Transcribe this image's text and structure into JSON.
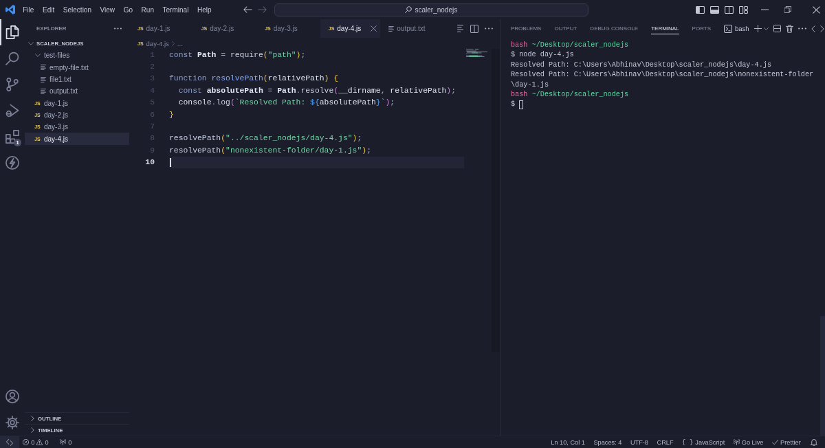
{
  "title_bar": {
    "menu": [
      "File",
      "Edit",
      "Selection",
      "View",
      "Go",
      "Run",
      "Terminal",
      "Help"
    ],
    "search": "scaler_nodejs"
  },
  "activity_bar": {
    "items": [
      {
        "kind": "explorer",
        "selected": true
      },
      {
        "kind": "search",
        "selected": false
      },
      {
        "kind": "source-control",
        "selected": false
      },
      {
        "kind": "run-debug",
        "selected": false
      },
      {
        "kind": "extensions",
        "selected": false,
        "badge": "1"
      },
      {
        "kind": "lightning",
        "selected": false
      }
    ],
    "bottom": [
      {
        "kind": "account"
      },
      {
        "kind": "settings"
      }
    ]
  },
  "sidebar": {
    "title": "EXPLORER",
    "folder": {
      "label": "SCALER_NODEJS",
      "expanded": true,
      "children": [
        {
          "label": "test-files",
          "kind": "folder",
          "expanded": true,
          "selected": false,
          "children": [
            {
              "label": "empty-file.txt",
              "kind": "text",
              "selected": false
            },
            {
              "label": "file1.txt",
              "kind": "text",
              "selected": false
            },
            {
              "label": "output.txt",
              "kind": "text",
              "selected": false
            }
          ]
        },
        {
          "label": "day-1.js",
          "kind": "js",
          "icon_text": "JS",
          "selected": false
        },
        {
          "label": "day-2.js",
          "kind": "js",
          "icon_text": "JS",
          "selected": false
        },
        {
          "label": "day-3.js",
          "kind": "js",
          "icon_text": "JS",
          "selected": false
        },
        {
          "label": "day-4.js",
          "kind": "js",
          "icon_text": "JS",
          "selected": true
        }
      ]
    },
    "sections": [
      {
        "label": "OUTLINE",
        "expanded": false
      },
      {
        "label": "TIMELINE",
        "expanded": false
      }
    ]
  },
  "editor": {
    "tabs": [
      {
        "label": "day-1.js",
        "kind": "js",
        "icon_text": "JS",
        "selected": false
      },
      {
        "label": "day-2.js",
        "kind": "js",
        "icon_text": "JS",
        "selected": false
      },
      {
        "label": "day-3.js",
        "kind": "js",
        "icon_text": "JS",
        "selected": false
      },
      {
        "label": "day-4.js",
        "kind": "js",
        "icon_text": "JS",
        "selected": true
      },
      {
        "label": "output.txt",
        "kind": "text",
        "selected": false
      }
    ],
    "breadcrumb": [
      {
        "label": "day-4.js",
        "kind": "js",
        "icon_text": "JS"
      },
      {
        "label": "...",
        "kind": "more"
      }
    ],
    "lines": [
      {
        "number": "1",
        "current": false,
        "tokens": [
          {
            "text": "const ",
            "kind": "keyword"
          },
          {
            "text": "Path",
            "kind": "variable"
          },
          {
            "text": " = ",
            "kind": "plain"
          },
          {
            "text": "require",
            "kind": "call"
          },
          {
            "text": "(",
            "kind": "bracket1"
          },
          {
            "text": "\"path\"",
            "kind": "string"
          },
          {
            "text": ")",
            "kind": "bracket1"
          },
          {
            "text": ";",
            "kind": "plain"
          }
        ]
      },
      {
        "number": "2",
        "current": false
      },
      {
        "number": "3",
        "current": false,
        "tokens": [
          {
            "text": "function ",
            "kind": "keyword"
          },
          {
            "text": "resolvePath",
            "kind": "function"
          },
          {
            "text": "(",
            "kind": "bracket1"
          },
          {
            "text": "relativePath",
            "kind": "parameter"
          },
          {
            "text": ")",
            "kind": "bracket1"
          },
          {
            "text": " {",
            "kind": "bracket1"
          }
        ]
      },
      {
        "number": "4",
        "current": false,
        "tokens": [
          {
            "text": "  const ",
            "kind": "keyword"
          },
          {
            "text": "absolutePath",
            "kind": "variable"
          },
          {
            "text": " = ",
            "kind": "plain"
          },
          {
            "text": "Path",
            "kind": "variable"
          },
          {
            "text": ".",
            "kind": "plain"
          },
          {
            "text": "resolve",
            "kind": "call"
          },
          {
            "text": "(",
            "kind": "bracket2"
          },
          {
            "text": "__dirname",
            "kind": "identifier"
          },
          {
            "text": ", ",
            "kind": "plain"
          },
          {
            "text": "relativePath",
            "kind": "identifier"
          },
          {
            "text": ")",
            "kind": "bracket2"
          },
          {
            "text": ";",
            "kind": "plain"
          }
        ]
      },
      {
        "number": "5",
        "current": false,
        "tokens": [
          {
            "text": "  console",
            "kind": "identifier"
          },
          {
            "text": ".",
            "kind": "plain"
          },
          {
            "text": "log",
            "kind": "call"
          },
          {
            "text": "(",
            "kind": "bracket2"
          },
          {
            "text": "`Resolved Path: ",
            "kind": "string"
          },
          {
            "text": "${",
            "kind": "interpolation"
          },
          {
            "text": "absolutePath",
            "kind": "identifier"
          },
          {
            "text": "}",
            "kind": "interpolation"
          },
          {
            "text": "`",
            "kind": "string"
          },
          {
            "text": ")",
            "kind": "bracket2"
          },
          {
            "text": ";",
            "kind": "plain"
          }
        ]
      },
      {
        "number": "6",
        "current": false,
        "tokens": [
          {
            "text": "}",
            "kind": "bracket1"
          }
        ]
      },
      {
        "number": "7",
        "current": false
      },
      {
        "number": "8",
        "current": false,
        "tokens": [
          {
            "text": "resolvePath",
            "kind": "call"
          },
          {
            "text": "(",
            "kind": "bracket1"
          },
          {
            "text": "\"../scaler_nodejs/day-4.js\"",
            "kind": "string"
          },
          {
            "text": ")",
            "kind": "bracket1"
          },
          {
            "text": ";",
            "kind": "plain"
          }
        ]
      },
      {
        "number": "9",
        "current": false,
        "tokens": [
          {
            "text": "resolvePath",
            "kind": "call"
          },
          {
            "text": "(",
            "kind": "bracket1"
          },
          {
            "text": "\"nonexistent-folder/day-1.js\"",
            "kind": "string"
          },
          {
            "text": ")",
            "kind": "bracket1"
          },
          {
            "text": ";",
            "kind": "plain"
          }
        ]
      },
      {
        "number": "10",
        "current": true
      }
    ]
  },
  "panel": {
    "tabs": [
      {
        "label": "PROBLEMS",
        "selected": false
      },
      {
        "label": "OUTPUT",
        "selected": false
      },
      {
        "label": "DEBUG CONSOLE",
        "selected": false
      },
      {
        "label": "TERMINAL",
        "selected": true
      },
      {
        "label": "PORTS",
        "selected": false
      }
    ],
    "terminal": {
      "name": "bash",
      "lines": [
        {
          "kind": "prompt",
          "shell": "bash",
          "path": "~/Desktop/scaler_nodejs"
        },
        {
          "kind": "command",
          "symbol": "$",
          "text": "node day-4.js"
        },
        {
          "kind": "output",
          "text": "Resolved Path: C:\\Users\\Abhinav\\Desktop\\scaler_nodejs\\day-4.js"
        },
        {
          "kind": "output",
          "text": "Resolved Path: C:\\Users\\Abhinav\\Desktop\\scaler_nodejs\\nonexistent-folder"
        },
        {
          "kind": "output",
          "text": "\\day-1.js"
        },
        {
          "kind": "prompt",
          "shell": "bash",
          "path": "~/Desktop/scaler_nodejs"
        },
        {
          "kind": "input",
          "symbol": "$",
          "cursor": true
        }
      ]
    }
  },
  "status_bar": {
    "problems": {
      "errors": "0",
      "warnings": "0"
    },
    "ports": "0",
    "items": [
      {
        "text": "Ln 10, Col 1",
        "kind": "position"
      },
      {
        "text": "Spaces: 4",
        "kind": "indentation"
      },
      {
        "text": "UTF-8",
        "kind": "encoding"
      },
      {
        "text": "CRLF",
        "kind": "line-ending"
      },
      {
        "text": "JavaScript",
        "kind": "language",
        "symbol": "{ }"
      },
      {
        "text": "Go Live",
        "kind": "live-server"
      },
      {
        "text": "Prettier",
        "kind": "formatter"
      }
    ]
  }
}
